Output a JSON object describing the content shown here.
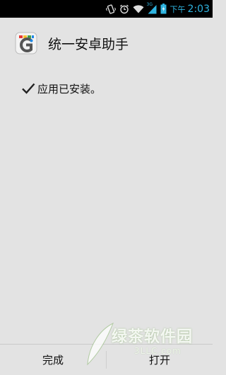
{
  "status_bar": {
    "ampm": "下午",
    "time": "2:03",
    "network_label": "3G",
    "accent_color": "#2fb4e0",
    "icons": [
      "vibrate-icon",
      "alarm-icon",
      "wifi-icon",
      "signal-icon",
      "battery-icon"
    ]
  },
  "header": {
    "app_title": "统一安卓助手",
    "app_icon": "app-logo-icon"
  },
  "message": {
    "text": "应用已安装。",
    "icon": "check-icon"
  },
  "buttons": {
    "done_label": "完成",
    "open_label": "打开"
  },
  "watermark": {
    "title": "绿茶软件园",
    "subtitle": "3LLC.com"
  }
}
